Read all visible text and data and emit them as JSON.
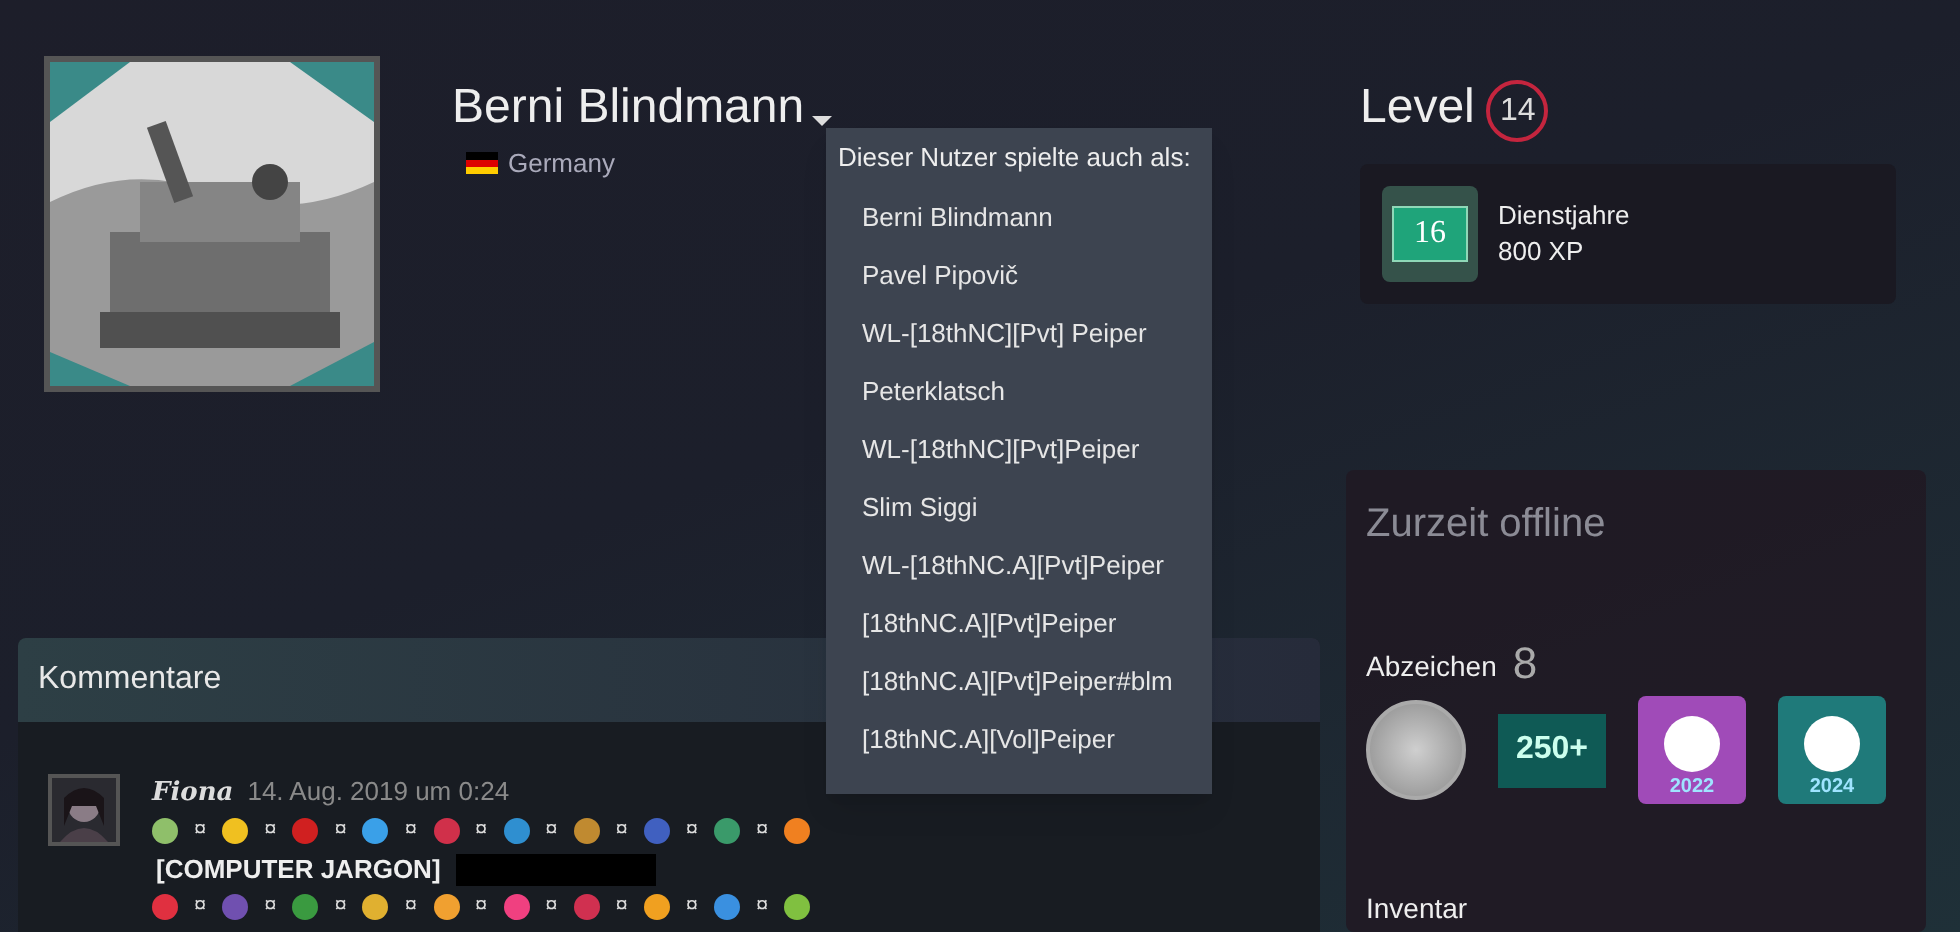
{
  "profile": {
    "name": "Berni Blindmann",
    "country": "Germany"
  },
  "aliases_menu": {
    "title": "Dieser Nutzer spielte auch als:",
    "items": [
      "Berni Blindmann",
      "Pavel Pipovič",
      "WL-[18thNC][Pvt] Peiper",
      "Peterklatsch",
      "WL-[18thNC][Pvt]Peiper",
      "Slim Siggi",
      "WL-[18thNC.A][Pvt]Peiper",
      "[18thNC.A][Pvt]Peiper",
      "[18thNC.A][Pvt]Peiper#blm",
      "[18thNC.A][Vol]Peiper"
    ]
  },
  "level": {
    "label": "Level",
    "value": "14",
    "badge": {
      "number": "16",
      "title": "Dienstjahre",
      "xp": "800 XP"
    }
  },
  "status": {
    "text": "Zurzeit offline"
  },
  "badges": {
    "label": "Abzeichen",
    "count": "8",
    "items": [
      {
        "kind": "coin"
      },
      {
        "kind": "tile",
        "text": "250+"
      },
      {
        "kind": "steam",
        "text": "2022",
        "color": "#a04bb8"
      },
      {
        "kind": "steam",
        "text": "2024",
        "color": "#1f7a7a"
      }
    ]
  },
  "inventory": {
    "label": "Inventar"
  },
  "comments": {
    "title": "Kommentare",
    "items": [
      {
        "author": "Fiona",
        "date": "14. Aug. 2019 um 0:24",
        "lines": [
          {
            "items": [
              {
                "kind": "emoticon",
                "color": "#8fbf6a"
              },
              {
                "kind": "text",
                "text": "¤"
              },
              {
                "kind": "emoticon",
                "color": "#f0c020"
              },
              {
                "kind": "text",
                "text": "¤"
              },
              {
                "kind": "emoticon",
                "color": "#d02020"
              },
              {
                "kind": "text",
                "text": "¤"
              },
              {
                "kind": "emoticon",
                "color": "#3aa0e8"
              },
              {
                "kind": "text",
                "text": "¤"
              },
              {
                "kind": "emoticon",
                "color": "#d0304a"
              },
              {
                "kind": "text",
                "text": "¤"
              },
              {
                "kind": "emoticon",
                "color": "#2f8fd0"
              },
              {
                "kind": "text",
                "text": "¤"
              },
              {
                "kind": "emoticon",
                "color": "#c08a30"
              },
              {
                "kind": "text",
                "text": "¤"
              },
              {
                "kind": "emoticon",
                "color": "#4060c0"
              },
              {
                "kind": "text",
                "text": "¤"
              },
              {
                "kind": "emoticon",
                "color": "#3a9a6a"
              },
              {
                "kind": "text",
                "text": "¤"
              },
              {
                "kind": "emoticon",
                "color": "#f08020"
              }
            ]
          },
          {
            "items": [
              {
                "kind": "bold",
                "text": "[COMPUTER JARGON]"
              },
              {
                "kind": "redacted"
              }
            ]
          },
          {
            "items": [
              {
                "kind": "emoticon",
                "color": "#e03040"
              },
              {
                "kind": "text",
                "text": "¤"
              },
              {
                "kind": "emoticon",
                "color": "#7050b0"
              },
              {
                "kind": "text",
                "text": "¤"
              },
              {
                "kind": "emoticon",
                "color": "#3a9a40"
              },
              {
                "kind": "text",
                "text": "¤"
              },
              {
                "kind": "emoticon",
                "color": "#e0b030"
              },
              {
                "kind": "text",
                "text": "¤"
              },
              {
                "kind": "emoticon",
                "color": "#f0a030"
              },
              {
                "kind": "text",
                "text": "¤"
              },
              {
                "kind": "emoticon",
                "color": "#f04080"
              },
              {
                "kind": "text",
                "text": "¤"
              },
              {
                "kind": "emoticon",
                "color": "#d03050"
              },
              {
                "kind": "text",
                "text": "¤"
              },
              {
                "kind": "emoticon",
                "color": "#f0a020"
              },
              {
                "kind": "text",
                "text": "¤"
              },
              {
                "kind": "emoticon",
                "color": "#3a90e0"
              },
              {
                "kind": "text",
                "text": "¤"
              },
              {
                "kind": "emoticon",
                "color": "#80c040"
              }
            ]
          }
        ]
      }
    ]
  }
}
